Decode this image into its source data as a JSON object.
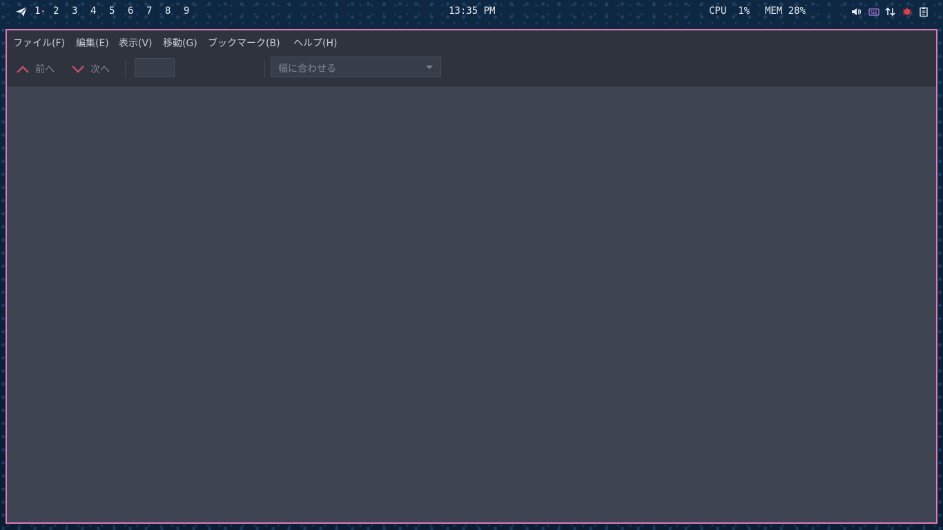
{
  "topbar": {
    "workspaces": [
      "1",
      "2",
      "3",
      "4",
      "5",
      "6",
      "7",
      "8",
      "9"
    ],
    "clock": "13:35 PM",
    "cpu_label": "CPU  1%",
    "mem_label": "MEM 28%",
    "tray_icons": [
      "volume-icon",
      "keyboard-icon",
      "network-arrows-icon",
      "bug-icon",
      "clipboard-icon"
    ]
  },
  "menubar": {
    "items": [
      "ファイル(F)",
      "編集(E)",
      "表示(V)",
      "移動(G)",
      "ブックマーク(B)",
      "ヘルプ(H)"
    ]
  },
  "toolbar": {
    "prev_label": "前へ",
    "next_label": "次へ",
    "page_value": "",
    "zoom_label": "幅に合わせる"
  },
  "colors": {
    "window_border": "#e07ab8",
    "accent": "#c0506e",
    "content_bg": "#3d4350",
    "toolbar_bg": "#2e333d"
  }
}
